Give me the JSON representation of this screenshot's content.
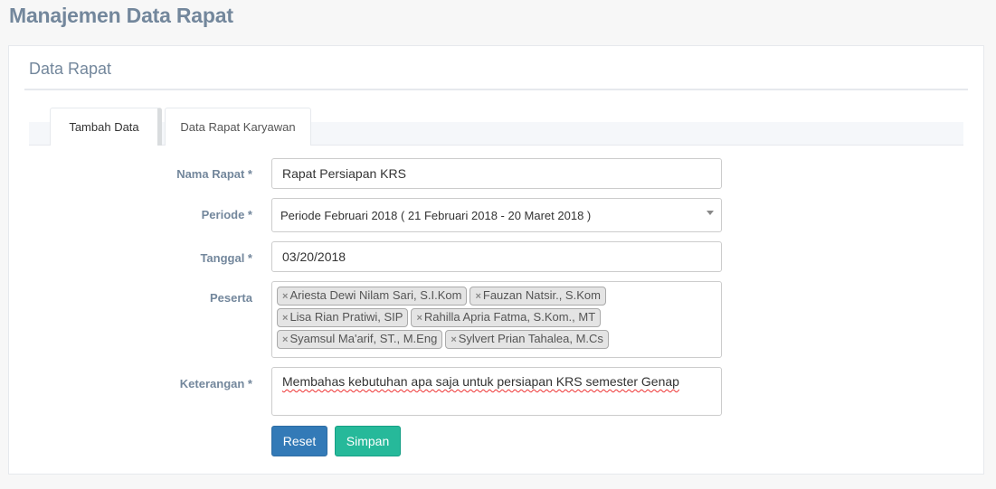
{
  "page_title": "Manajemen Data Rapat",
  "panel_title": "Data Rapat",
  "tabs": [
    {
      "label": "Tambah Data"
    },
    {
      "label": "Data Rapat Karyawan"
    }
  ],
  "form": {
    "nama_rapat": {
      "label": "Nama Rapat *",
      "value": "Rapat Persiapan KRS"
    },
    "periode": {
      "label": "Periode *",
      "value": "Periode Februari 2018 ( 21 Februari 2018 - 20 Maret 2018 )"
    },
    "tanggal": {
      "label": "Tanggal *",
      "value": "03/20/2018"
    },
    "peserta": {
      "label": "Peserta",
      "remove_symbol": "×",
      "tags": [
        "Ariesta Dewi Nilam Sari, S.I.Kom",
        "Fauzan Natsir., S.Kom",
        "Lisa Rian Pratiwi, SIP",
        "Rahilla Apria Fatma, S.Kom., MT",
        "Syamsul Ma'arif, ST., M.Eng",
        "Sylvert Prian Tahalea, M.Cs"
      ]
    },
    "keterangan": {
      "label": "Keterangan *",
      "value": "Membahas kebutuhan apa saja untuk persiapan KRS semester Genap"
    }
  },
  "buttons": {
    "reset": "Reset",
    "simpan": "Simpan"
  }
}
